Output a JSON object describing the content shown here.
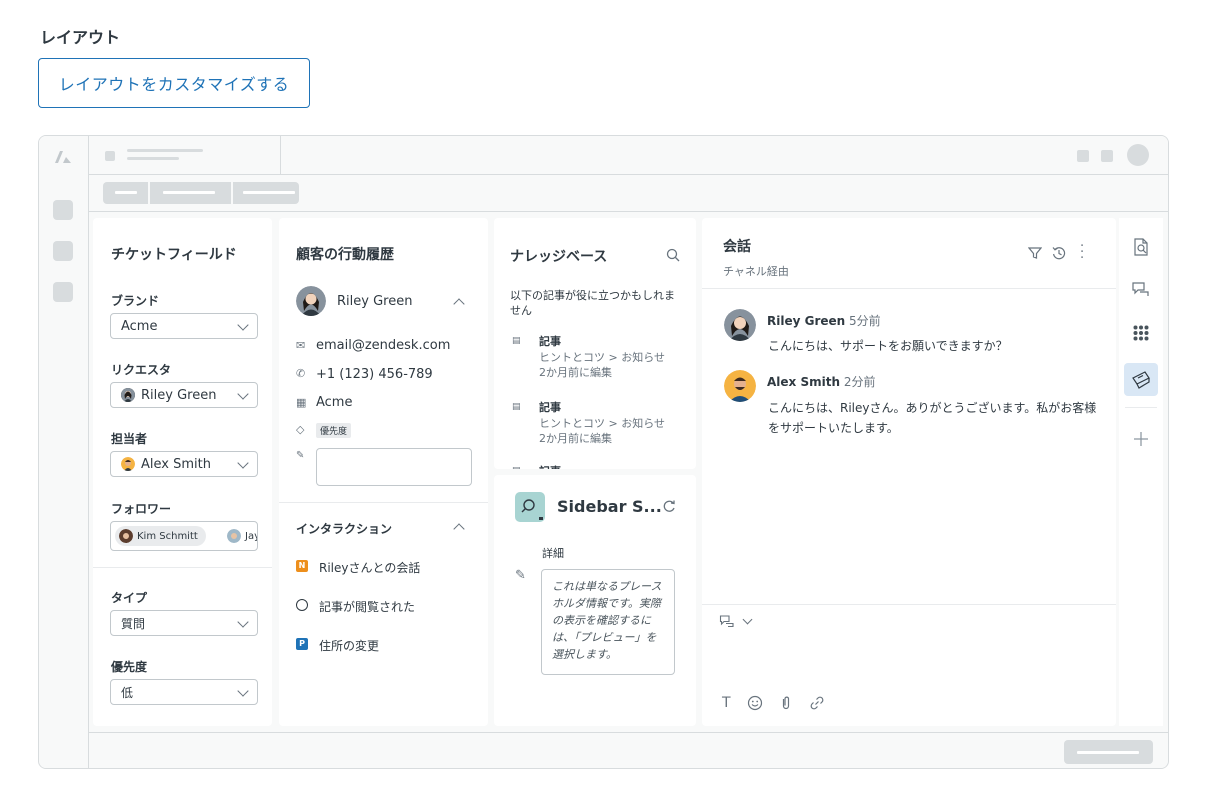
{
  "page": {
    "heading": "レイアウト",
    "customize_button": "レイアウトをカスタマイズする"
  },
  "ticket_fields": {
    "title": "チケットフィールド",
    "brand_label": "ブランド",
    "brand_value": "Acme",
    "requester_label": "リクエスタ",
    "requester_value": "Riley Green",
    "assignee_label": "担当者",
    "assignee_value": "Alex Smith",
    "followers_label": "フォロワー",
    "followers": [
      "Kim Schmitt",
      "Jay"
    ],
    "type_label": "タイプ",
    "type_value": "質問",
    "priority_label": "優先度",
    "priority_value": "低"
  },
  "customer": {
    "title": "顧客の行動履歴",
    "name": "Riley Green",
    "email": "email@zendesk.com",
    "phone": "+1 (123) 456-789",
    "org": "Acme",
    "tag": "優先度",
    "interactions_title": "インタラクション",
    "interactions": [
      {
        "icon": "N",
        "label": "Rileyさんとの会話"
      },
      {
        "icon": "circle",
        "label": "記事が閲覧された"
      },
      {
        "icon": "P",
        "label": "住所の変更"
      }
    ]
  },
  "knowledge": {
    "title": "ナレッジベース",
    "intro": "以下の記事が役に立つかもしれません",
    "articles": [
      {
        "title": "記事",
        "path": "ヒントとコツ > お知らせ",
        "edited": "2か月前に編集"
      },
      {
        "title": "記事",
        "path": "ヒントとコツ > お知らせ",
        "edited": "2か月前に編集"
      },
      {
        "title": "記事",
        "path": "",
        "edited": ""
      }
    ]
  },
  "app": {
    "title": "Sidebar S...",
    "detail_label": "詳細",
    "placeholder_text": "これは単なるプレースホルダ情報です。実際の表示を確認するには、「プレビュー」を選択します。"
  },
  "conversation": {
    "title": "会話",
    "subtitle": "チャネル経由",
    "messages": [
      {
        "author": "Riley Green",
        "time": "5分前",
        "text": "こんにちは、サポートをお願いできますか？"
      },
      {
        "author": "Alex Smith",
        "time": "2分前",
        "text": "こんにちは、Rileyさん。ありがとうございます。私がお客様をサポートいたします。"
      }
    ],
    "composer_format_icon": "T"
  },
  "colors": {
    "accent": "#1f73b7",
    "border": "#d8dcde",
    "nav_active_bg": "#d9e7f5",
    "n_badge": "#ed8f1c",
    "p_badge": "#1f73b7"
  }
}
